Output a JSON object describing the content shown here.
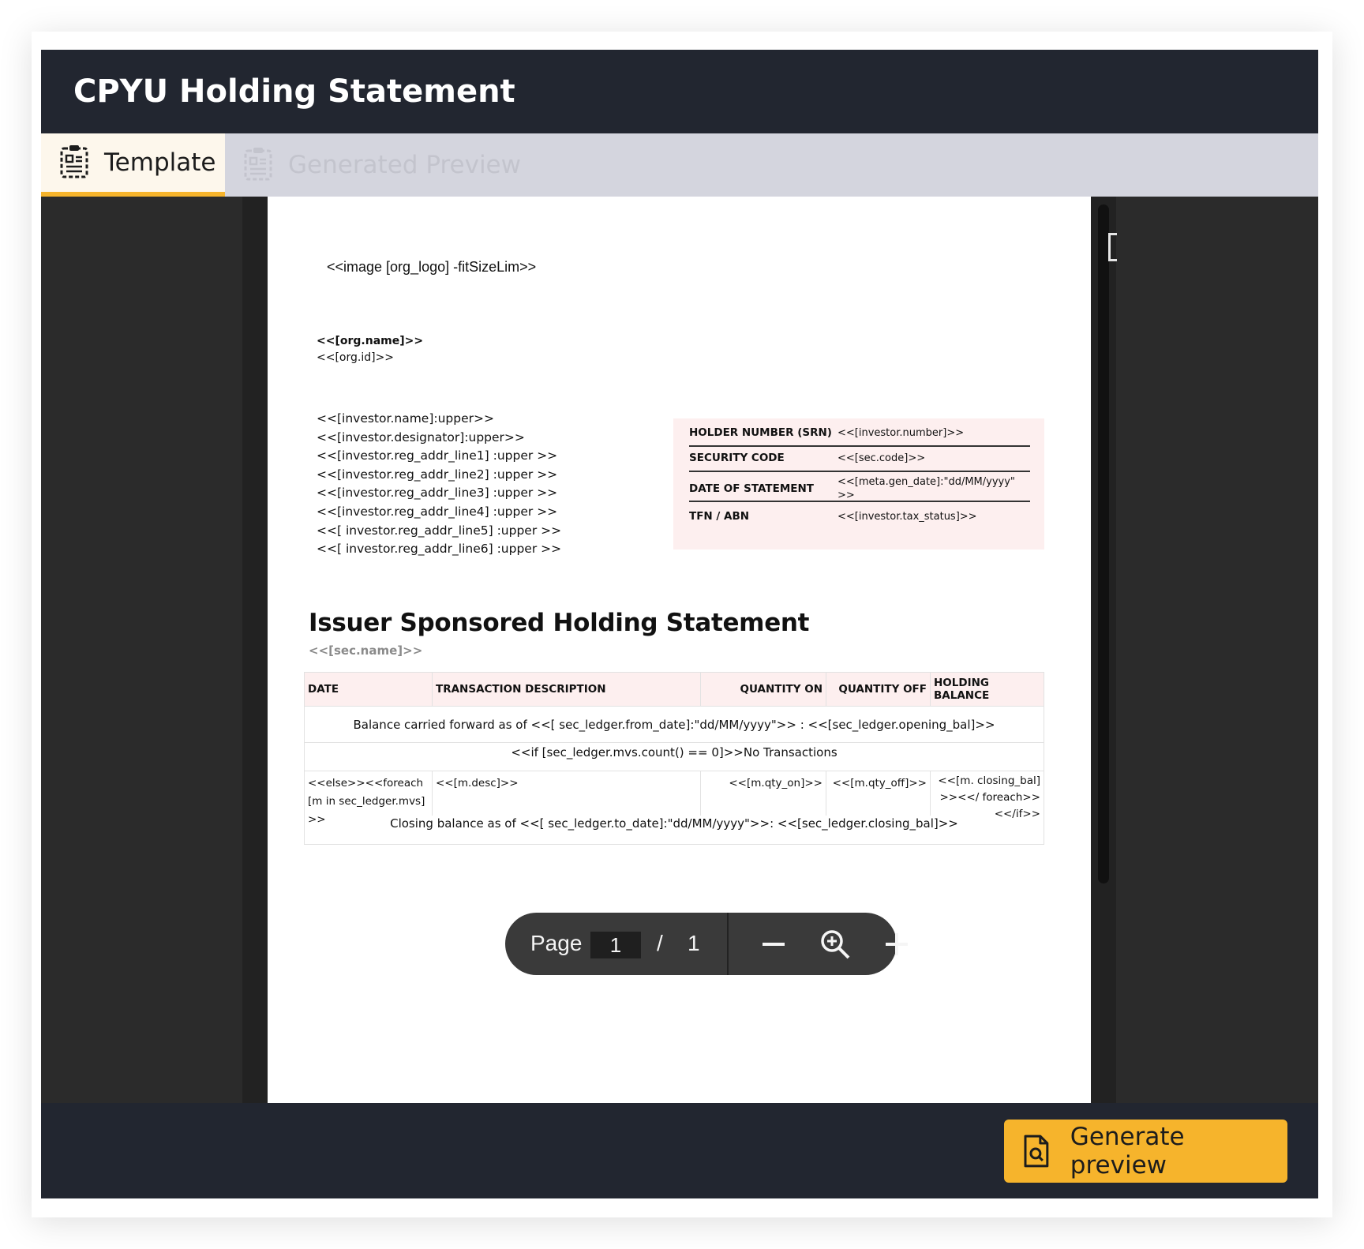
{
  "app": {
    "title": "CPYU Holding Statement"
  },
  "tabs": [
    {
      "label": "Template",
      "icon": "document-template-icon",
      "active": true
    },
    {
      "label": "Generated Preview",
      "icon": "document-preview-icon",
      "active": false
    }
  ],
  "document": {
    "logo_placeholder": "<<image [org_logo] -fitSizeLim>>",
    "org_name": "<<[org.name]>>",
    "org_id": "<<[org.id]>>",
    "address_lines": [
      "<<[investor.name]:upper>>",
      "<<[investor.designator]:upper>>",
      "<<[investor.reg_addr_line1] :upper >>",
      "<<[investor.reg_addr_line2] :upper >>",
      "<<[investor.reg_addr_line3] :upper >>",
      "<<[investor.reg_addr_line4] :upper >>",
      "<<[ investor.reg_addr_line5] :upper >>",
      "<<[ investor.reg_addr_line6] :upper >>"
    ],
    "holder_info": [
      {
        "label": "HOLDER NUMBER (SRN)",
        "value": "<<[investor.number]>>"
      },
      {
        "label": "SECURITY CODE",
        "value": "<<[sec.code]>>"
      },
      {
        "label": "DATE OF STATEMENT",
        "value": "<<[meta.gen_date]:\"dd/MM/yyyy\" >>"
      },
      {
        "label": "TFN / ABN",
        "value": "<<[investor.tax_status]>>"
      }
    ],
    "heading": "Issuer Sponsored Holding Statement",
    "subheading": "<<[sec.name]>>",
    "ledger": {
      "columns": [
        "DATE",
        "TRANSACTION DESCRIPTION",
        "QUANTITY ON",
        "QUANTITY OFF",
        "HOLDING BALANCE"
      ],
      "balance_forward": "Balance carried forward as of <<[ sec_ledger.from_date]:\"dd/MM/yyyy\">> : <<[sec_ledger.opening_bal]>>",
      "no_tx": "<<if [sec_ledger.mvs.count() == 0]>>No Transactions",
      "row": [
        "<<else>><<foreach [m in sec_ledger.mvs]>>",
        "<<[m.desc]>>",
        "<<[m.qty_on]>>",
        "<<[m.qty_off]>>",
        "<<[m. closing_bal]>><</ foreach>><</if>>"
      ],
      "closing": "Closing balance as of <<[ sec_ledger.to_date]:\"dd/MM/yyyy\">>: <<[sec_ledger.closing_bal]>>"
    }
  },
  "pager": {
    "label": "Page",
    "current": "1",
    "separator": "/",
    "total": "1"
  },
  "footer": {
    "generate_label": "Generate preview"
  }
}
